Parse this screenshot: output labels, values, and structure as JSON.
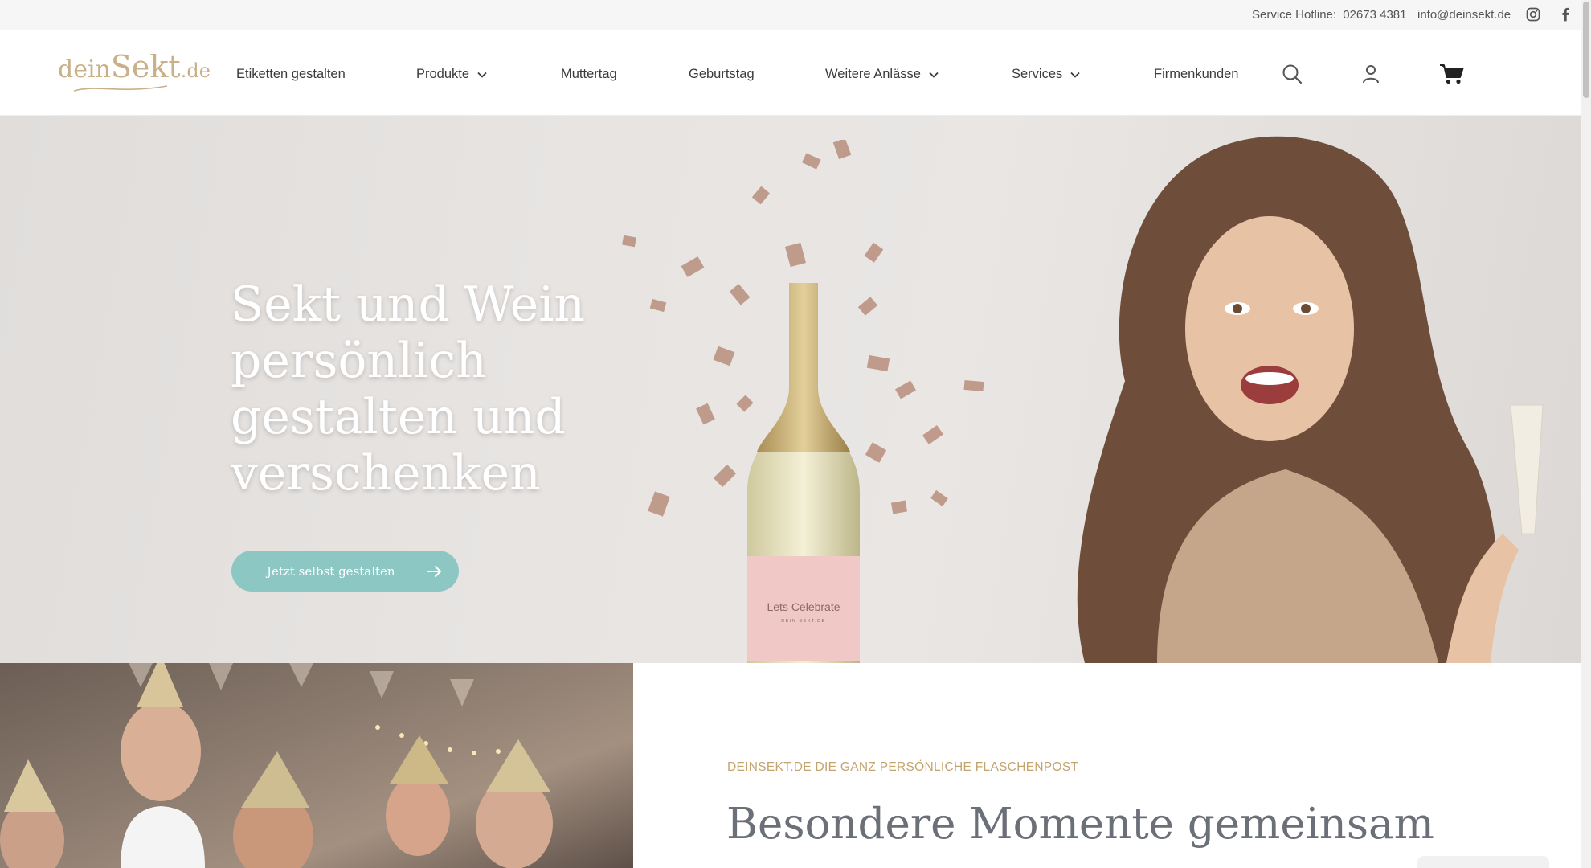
{
  "topbar": {
    "hotline_label": "Service Hotline:",
    "hotline_number": "02673 4381",
    "email": "info@deinsekt.de",
    "social": [
      "instagram-icon",
      "facebook-icon"
    ]
  },
  "logo": {
    "pre": "dein",
    "main": "Sekt",
    "suffix": ".de"
  },
  "nav": {
    "items": [
      {
        "label": "Etiketten gestalten",
        "dropdown": false
      },
      {
        "label": "Produkte",
        "dropdown": true
      },
      {
        "label": "Muttertag",
        "dropdown": false
      },
      {
        "label": "Geburtstag",
        "dropdown": false
      },
      {
        "label": "Weitere Anlässe",
        "dropdown": true
      },
      {
        "label": "Services",
        "dropdown": true
      },
      {
        "label": "Firmenkunden",
        "dropdown": false
      }
    ],
    "icons": [
      "search-icon",
      "user-icon",
      "cart-icon"
    ]
  },
  "hero": {
    "title_lines": [
      "Sekt und Wein",
      "persönlich",
      "gestalten und",
      "verschenken"
    ],
    "cta_label": "Jetzt selbst gestalten",
    "bottle_label": "Lets Celebrate",
    "bottle_sublabel": "DEIN SEKT.DE"
  },
  "section": {
    "eyebrow": "DEINSEKT.DE DIE GANZ PERSÖNLICHE FLASCHENPOST",
    "title": "Besondere Momente gemeinsam"
  },
  "colors": {
    "accent_teal": "#8cc7c3",
    "gold": "#c2a46e",
    "heading_gray": "#6b6f78",
    "topbar_bg": "#f6f6f6"
  }
}
